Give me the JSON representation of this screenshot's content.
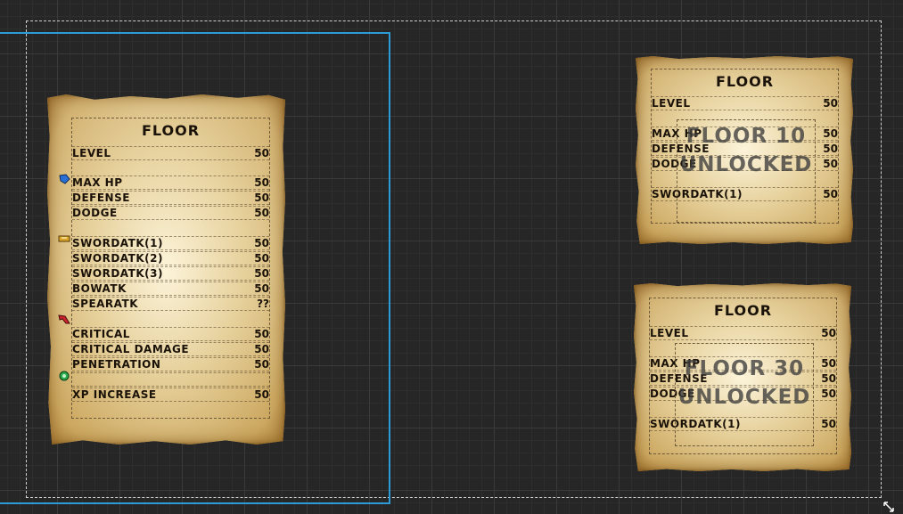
{
  "left_card": {
    "title": "FLOOR",
    "rows": [
      {
        "label": "LEVEL",
        "value": "50"
      },
      {
        "label": "MAX HP",
        "value": "50"
      },
      {
        "label": "DEFENSE",
        "value": "50"
      },
      {
        "label": "DODGE",
        "value": "50"
      },
      {
        "label": "SWORDATK(1)",
        "value": "50"
      },
      {
        "label": "SWORDATK(2)",
        "value": "50"
      },
      {
        "label": "SWORDATK(3)",
        "value": "50"
      },
      {
        "label": "BOWATK",
        "value": "50"
      },
      {
        "label": "SPEARATK",
        "value": "??"
      },
      {
        "label": "CRITICAL",
        "value": "50"
      },
      {
        "label": "CRITICAL DAMAGE",
        "value": "50"
      },
      {
        "label": "PENETRATION",
        "value": "50"
      },
      {
        "label": "XP INCREASE",
        "value": "50"
      }
    ],
    "icons": [
      "shield-icon",
      "sword-icon",
      "axe-icon",
      "xp-icon"
    ]
  },
  "top_card": {
    "title": "FLOOR",
    "rows": [
      {
        "label": "LEVEL",
        "value": "50"
      },
      {
        "label": "MAX HP",
        "value": "50"
      },
      {
        "label": "DEFENSE",
        "value": "50"
      },
      {
        "label": "DODGE",
        "value": "50"
      },
      {
        "label": "SWORDATK(1)",
        "value": "50"
      }
    ],
    "overlay_line1": "FLOOR 10",
    "overlay_line2": "UNLOCKED"
  },
  "bottom_card": {
    "title": "FLOOR",
    "rows": [
      {
        "label": "LEVEL",
        "value": "50"
      },
      {
        "label": "MAX HP",
        "value": "50"
      },
      {
        "label": "DEFENSE",
        "value": "50"
      },
      {
        "label": "DODGE",
        "value": "50"
      },
      {
        "label": "SWORDATK(1)",
        "value": "50"
      }
    ],
    "overlay_line1": "FLOOR 30",
    "overlay_line2": "UNLOCKED"
  },
  "colors": {
    "canvas_bg": "#262626",
    "selection": "#2f9bd6",
    "ink": "#1a1208",
    "overlay_text": "#3c3c3c"
  }
}
